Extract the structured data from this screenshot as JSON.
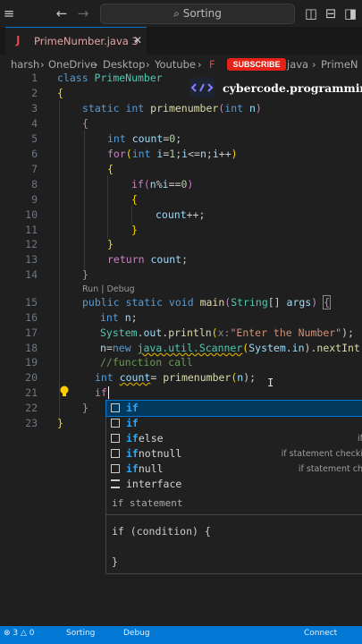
{
  "titlebar": {
    "search_label": "Sorting"
  },
  "tab": {
    "icon": "J",
    "name": "PrimeNumber.java 3",
    "close": "✕"
  },
  "breadcrumbs": {
    "b1": "harsh",
    "b2": "OneDrive",
    "b3": "Desktop",
    "b4": "Youtube",
    "b5": "F",
    "b6": "java",
    "b7": "PrimeN"
  },
  "overlay": {
    "subscribe": "SUBSCRIBE",
    "brand": "cybercode.programming"
  },
  "codelens": "Run | Debug",
  "line_numbers": [
    "1",
    "2",
    "3",
    "4",
    "5",
    "6",
    "7",
    "8",
    "9",
    "10",
    "11",
    "12",
    "13",
    "14",
    "15",
    "16",
    "17",
    "18",
    "19",
    "20",
    "21",
    "22",
    "23"
  ],
  "code": {
    "l1a": "class ",
    "l1b": "PrimeNumber",
    "l2": "{",
    "l3a": "static int ",
    "l3b": "primenumber",
    "l3c": "(",
    "l3d": "int ",
    "l3e": "n",
    "l3f": ")",
    "l4": "{",
    "l5a": "int ",
    "l5b": "count",
    "l5c": "=",
    "l5d": "0",
    "l5e": ";",
    "l6a": "for",
    "l6b": "(",
    "l6c": "int ",
    "l6d": "i",
    "l6e": "=",
    "l6f": "1",
    "l6g": ";",
    "l6h": "i",
    "l6i": "<=",
    "l6j": "n",
    "l6k": ";",
    "l6l": "i",
    "l6m": "++",
    "l6n": ")",
    "l7": "{",
    "l8a": "if",
    "l8b": "(",
    "l8c": "n",
    "l8d": "%",
    "l8e": "i",
    "l8f": "==",
    "l8g": "0",
    "l8h": ")",
    "l9": "{",
    "l10a": "count",
    "l10b": "++;",
    "l11": "}",
    "l12": "}",
    "l13a": "return ",
    "l13b": "count",
    "l13c": ";",
    "l14": "}",
    "l15a": "public static void ",
    "l15b": "main",
    "l15c": "(",
    "l15d": "String",
    "l15e": "[] ",
    "l15f": "args",
    "l15g": ") ",
    "l15h": "{",
    "l16a": "int ",
    "l16b": "n",
    "l16c": ";",
    "l17a": "System",
    "l17b": ".",
    "l17c": "out",
    "l17d": ".",
    "l17e": "println",
    "l17f": "(",
    "l17g": "x:",
    "l17h": "\"Enter the Number\"",
    "l17i": ");",
    "l18a": "n",
    "l18b": "=",
    "l18c": "new ",
    "l18d": "java.util.Scanner",
    "l18e": "(",
    "l18f": "System.in",
    "l18g": ").",
    "l18h": "nextInt",
    "l18i": "(",
    "l19": "//function call",
    "l20a": "int ",
    "l20b": "count",
    "l20c": "= ",
    "l20d": "primenumber",
    "l20e": "(",
    "l20f": "n",
    "l20g": ");",
    "l21": "if",
    "l22": "}",
    "l23": "}"
  },
  "suggestions": [
    {
      "match": "if",
      "rest": "",
      "detail": ""
    },
    {
      "match": "if",
      "rest": "",
      "detail": ""
    },
    {
      "match": "if",
      "rest": "else",
      "detail": "if"
    },
    {
      "match": "if",
      "rest": "notnull",
      "detail": "if statement checki"
    },
    {
      "match": "if",
      "rest": "null",
      "detail": "if statement ch"
    },
    {
      "match": "",
      "rest": "interface",
      "detail": ""
    }
  ],
  "docs": {
    "title": "if statement",
    "line1": "if (condition) {",
    "line2": "",
    "line3": "}"
  },
  "status": {
    "s1": "⊗ 3 △ 0",
    "s2": "Sorting",
    "s3": "Debug",
    "s4": "Connect"
  }
}
